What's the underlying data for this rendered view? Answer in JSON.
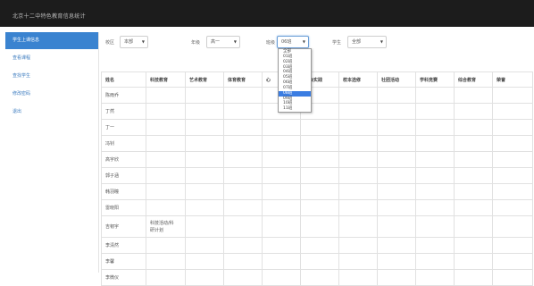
{
  "app": {
    "title": "北京十二中特色教育信息统计"
  },
  "sidebar": {
    "items": [
      {
        "label": "学生上课信息"
      },
      {
        "label": "查看课程"
      },
      {
        "label": "查找学生"
      },
      {
        "label": "修改密码"
      },
      {
        "label": "退出"
      }
    ]
  },
  "filters": {
    "campus": {
      "label": "校区",
      "value": "本部"
    },
    "grade": {
      "label": "年级",
      "value": "高一"
    },
    "class": {
      "label": "班级",
      "value": "06班"
    },
    "student": {
      "label": "学生",
      "value": "全部"
    }
  },
  "class_dropdown": {
    "options": [
      "全部",
      "01班",
      "02班",
      "03班",
      "04班",
      "05班",
      "06班",
      "07班",
      "08班",
      "09班",
      "10班",
      "11班"
    ],
    "selected": "08班"
  },
  "table": {
    "headers": [
      "姓名",
      "科技教育",
      "艺术教育",
      "体育教育",
      "心",
      "社会实践",
      "校本选修",
      "社团活动",
      "学科竞赛",
      "综合教育",
      "荣誉"
    ],
    "rows": [
      {
        "name": "陈雨乔",
        "tech": ""
      },
      {
        "name": "丁然",
        "tech": ""
      },
      {
        "name": "丁一",
        "tech": ""
      },
      {
        "name": "冯钊",
        "tech": ""
      },
      {
        "name": "高宇欣",
        "tech": ""
      },
      {
        "name": "郭子涵",
        "tech": ""
      },
      {
        "name": "韩羽瞳",
        "tech": ""
      },
      {
        "name": "雷晓阳",
        "tech": ""
      },
      {
        "name": "吉韧宇",
        "tech": "科技活动/科研计划"
      },
      {
        "name": "李清然",
        "tech": ""
      },
      {
        "name": "李馨",
        "tech": ""
      },
      {
        "name": "李微仪",
        "tech": ""
      }
    ]
  }
}
